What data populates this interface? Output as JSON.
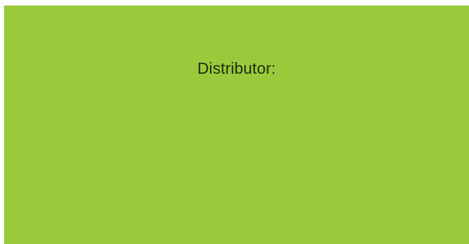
{
  "panel": {
    "label": "Distributor:"
  },
  "colors": {
    "panel_background": "#9aca3c",
    "text": "#1f2a10"
  }
}
